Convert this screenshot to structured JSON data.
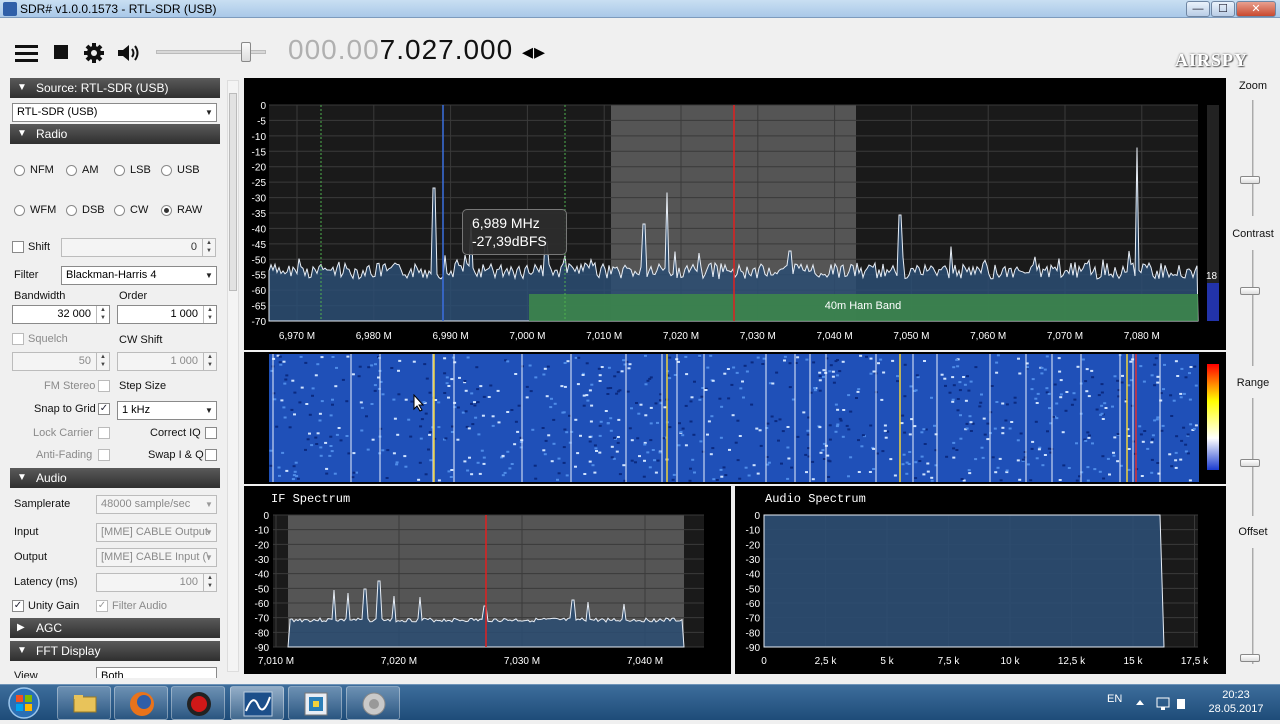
{
  "window": {
    "title": "SDR# v1.0.0.1573 - RTL-SDR (USB)",
    "min": "—",
    "max": "☐",
    "close": "✕"
  },
  "toolbar": {
    "menu_icon": "hamburger-icon",
    "stop_icon": "stop-icon",
    "settings_icon": "gear-icon",
    "volume_icon": "speaker-icon",
    "volume_level": 0.82,
    "freq_dim": "000.00",
    "freq_active": "7.027.000",
    "freq_arrows": "◂▸",
    "logo": "AIRSPY"
  },
  "source": {
    "header": "Source: RTL-SDR (USB)",
    "device": "RTL-SDR (USB)"
  },
  "radio": {
    "header": "Radio",
    "modes_row1": [
      "NFM",
      "AM",
      "LSB",
      "USB"
    ],
    "modes_row2": [
      "WFM",
      "DSB",
      "CW",
      "RAW"
    ],
    "selected_mode": "RAW",
    "shift_label": "Shift",
    "shift_value": "0",
    "filter_label": "Filter",
    "filter_value": "Blackman-Harris 4",
    "bandwidth_label": "Bandwidth",
    "bandwidth_value": "32 000",
    "order_label": "Order",
    "order_value": "1 000",
    "squelch_label": "Squelch",
    "squelch_value": "50",
    "cwshift_label": "CW Shift",
    "cwshift_value": "1 000",
    "fmstereo_label": "FM Stereo",
    "stepsize_label": "Step Size",
    "snap_label": "Snap to Grid",
    "snap_value": "1 kHz",
    "lockcarrier_label": "Lock Carrier",
    "correctiq_label": "Correct IQ",
    "antifading_label": "Anti-Fading",
    "swapiq_label": "Swap I & Q"
  },
  "audio": {
    "header": "Audio",
    "samplerate_label": "Samplerate",
    "samplerate_value": "48000 sample/sec",
    "input_label": "Input",
    "input_value": "[MME] CABLE Output",
    "output_label": "Output",
    "output_value": "[MME] CABLE Input (\\",
    "latency_label": "Latency (ms)",
    "latency_value": "100",
    "unitygain_label": "Unity Gain",
    "filteraudio_label": "Filter Audio"
  },
  "agc": {
    "header": "AGC"
  },
  "fft": {
    "header": "FFT Display",
    "view_label": "View",
    "view_value": "Both"
  },
  "right": {
    "zoom": "Zoom",
    "contrast": "Contrast",
    "range": "Range",
    "offset": "Offset"
  },
  "spectrum": {
    "y_ticks": [
      "0",
      "-5",
      "-10",
      "-15",
      "-20",
      "-25",
      "-30",
      "-35",
      "-40",
      "-45",
      "-50",
      "-55",
      "-60",
      "-65",
      "-70"
    ],
    "x_ticks": [
      "6,970 M",
      "6,980 M",
      "6,990 M",
      "7,000 M",
      "7,010 M",
      "7,020 M",
      "7,030 M",
      "7,040 M",
      "7,050 M",
      "7,060 M",
      "7,070 M",
      "7,080 M"
    ],
    "band_label": "40m Ham Band",
    "level_label": "18",
    "tooltip_freq": "6,989 MHz",
    "tooltip_level": "-27,39dBFS"
  },
  "if_spectrum": {
    "title": "IF Spectrum",
    "y_ticks": [
      "0",
      "-10",
      "-20",
      "-30",
      "-40",
      "-50",
      "-60",
      "-70",
      "-80",
      "-90"
    ],
    "x_ticks": [
      "7,010 M",
      "7,020 M",
      "7,030 M",
      "7,040 M"
    ]
  },
  "audio_spectrum": {
    "title": "Audio Spectrum",
    "y_ticks": [
      "0",
      "-10",
      "-20",
      "-30",
      "-40",
      "-50",
      "-60",
      "-70",
      "-80",
      "-90"
    ],
    "x_ticks": [
      "0",
      "2,5 k",
      "5 k",
      "7,5 k",
      "10 k",
      "12,5 k",
      "15 k",
      "17,5 k"
    ]
  },
  "taskbar": {
    "start_icon": "windows-start-icon",
    "apps": [
      "file-explorer-icon",
      "firefox-icon",
      "record-icon",
      "sdrsharp-icon",
      "app-icon",
      "speaker-app-icon"
    ],
    "lang": "EN",
    "time": "20:23",
    "date": "28.05.2017"
  },
  "colors": {
    "band_green": "#3d8a4a",
    "tuned_red": "#e02020",
    "marker_blue": "#3a6fe0",
    "passband_gray": "#555555"
  }
}
